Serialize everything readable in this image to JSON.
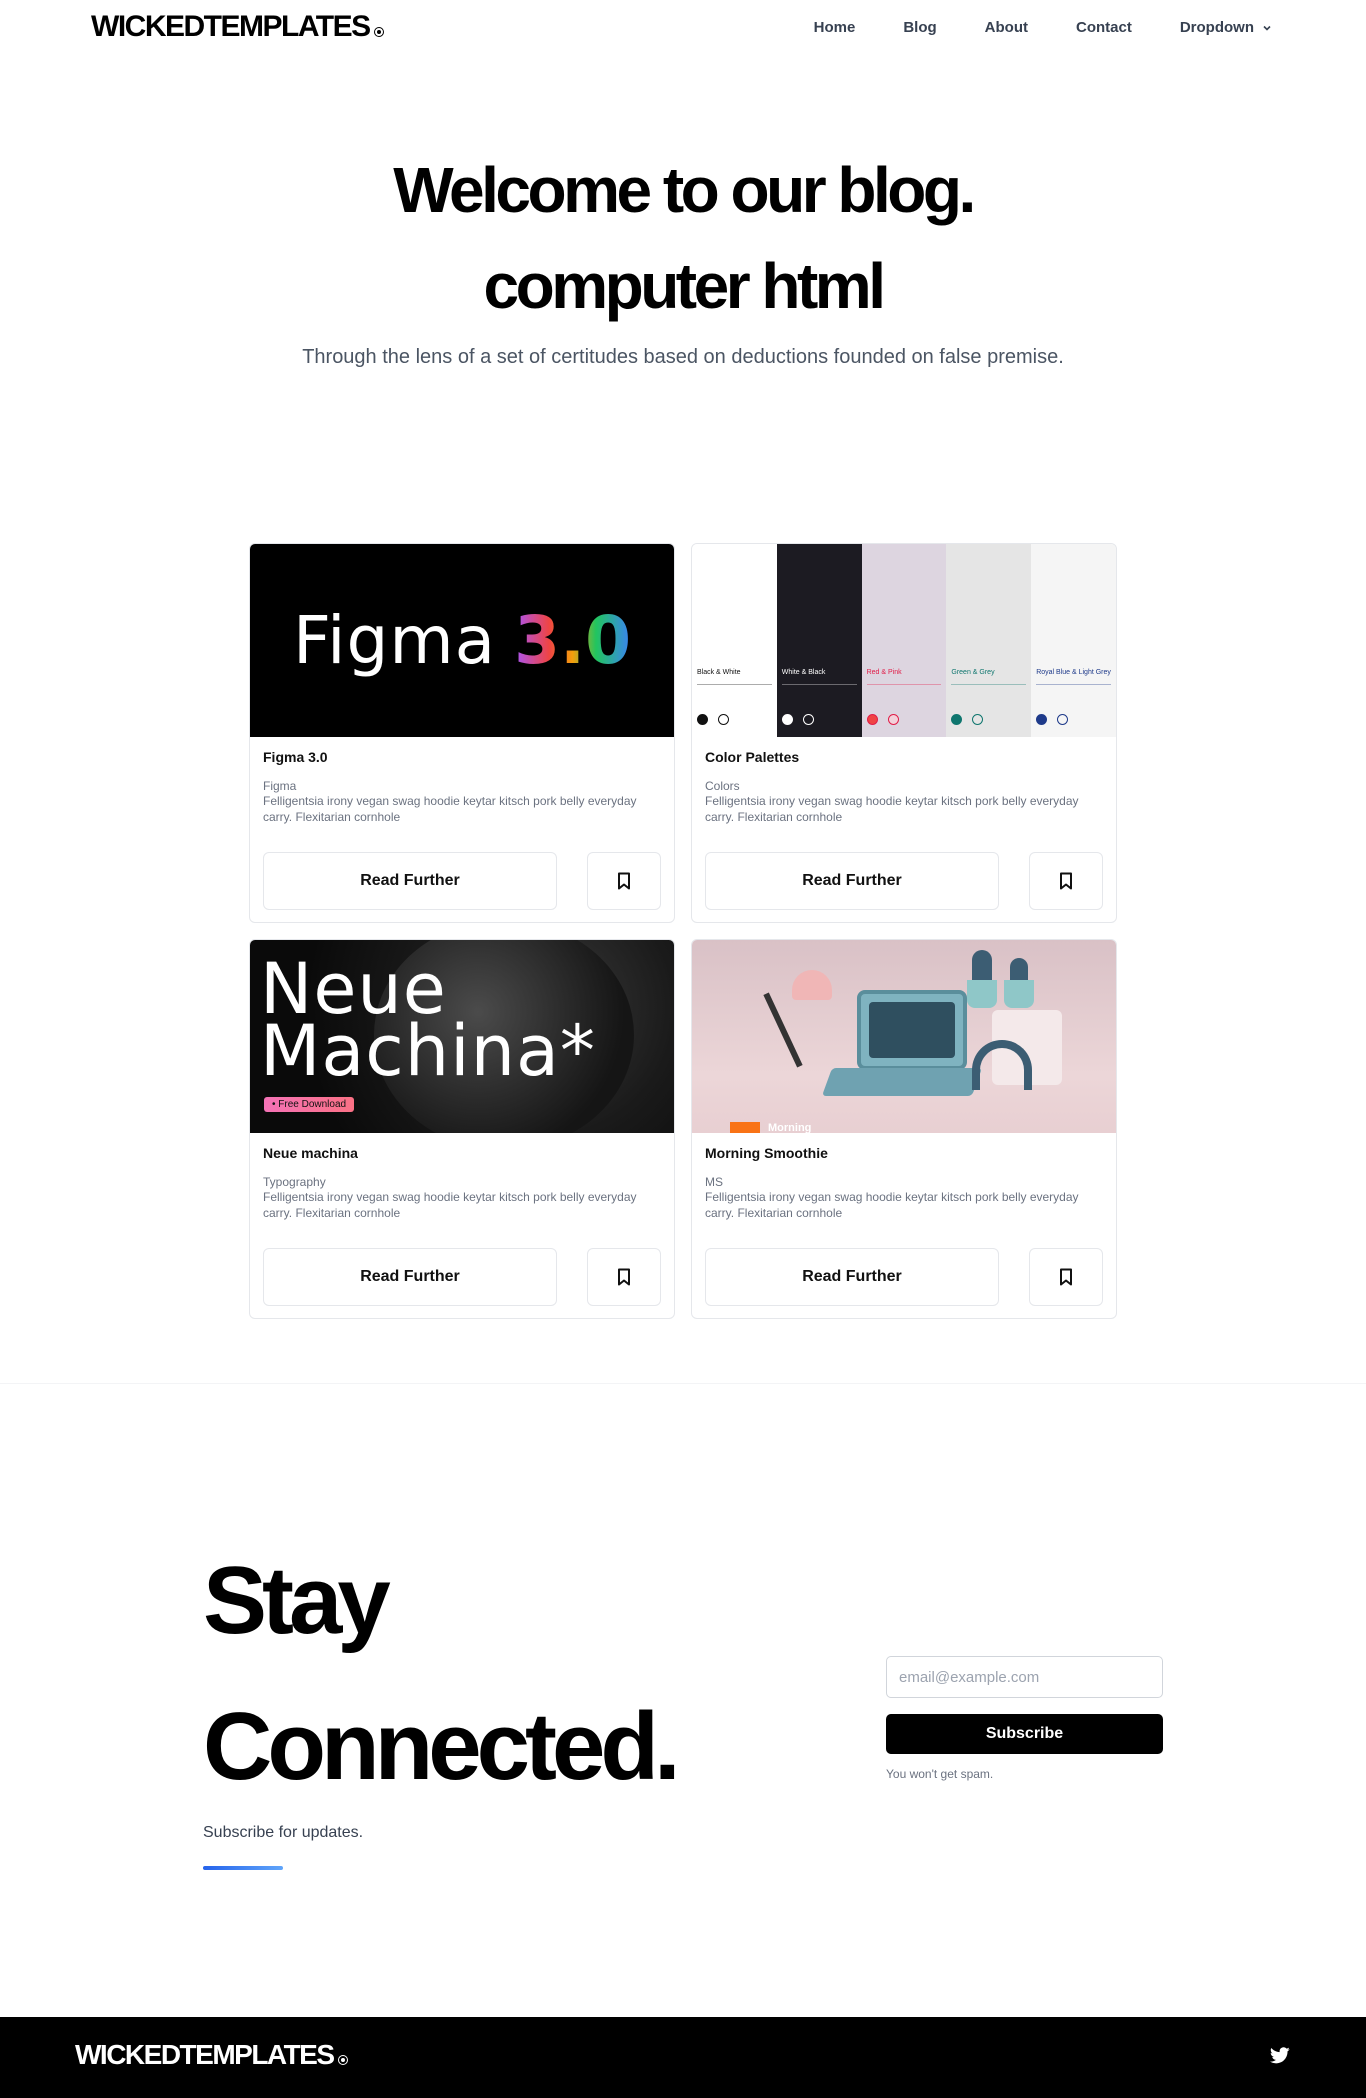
{
  "nav": {
    "brand": "WICKEDTEMPLATES",
    "links": [
      {
        "label": "Home"
      },
      {
        "label": "Blog"
      },
      {
        "label": "About"
      },
      {
        "label": "Contact"
      },
      {
        "label": "Dropdown"
      }
    ]
  },
  "hero": {
    "title_line1": "Welcome to our blog.",
    "title_line2": "computer html",
    "subtitle": "Through the lens of a set of certitudes based on deductions founded on false premise."
  },
  "cards": [
    {
      "title": "Figma 3.0",
      "category": "Figma",
      "description": "Felligentsia irony vegan swag hoodie keytar kitsch pork belly everyday carry. Flexitarian cornhole",
      "button": "Read Further",
      "image_text_1": "Figma",
      "image_text_2": "3.0"
    },
    {
      "title": "Color Palettes",
      "category": "Colors",
      "description": "Felligentsia irony vegan swag hoodie keytar kitsch pork belly everyday carry. Flexitarian cornhole",
      "button": "Read Further",
      "palettes": [
        {
          "label": "Black & White",
          "bg": "#ffffff",
          "fg": "#111111",
          "dot1": "#111111",
          "dot2": "#ffffff"
        },
        {
          "label": "White & Black",
          "bg": "#1c1b22",
          "fg": "#ffffff",
          "dot1": "#ffffff",
          "dot2": "#1c1b22"
        },
        {
          "label": "Red & Pink",
          "bg": "#ddd5e0",
          "fg": "#e11d48",
          "dot1": "#ef4444",
          "dot2": "#f3d1da"
        },
        {
          "label": "Green & Grey",
          "bg": "#e5e5e5",
          "fg": "#0f766e",
          "dot1": "#0f766e",
          "dot2": "#e5e5e5"
        },
        {
          "label": "Royal Blue & Light Grey",
          "bg": "#f5f5f5",
          "fg": "#1e3a8a",
          "dot1": "#1e3a8a",
          "dot2": "#f5f5f5"
        }
      ]
    },
    {
      "title": "Neue machina",
      "category": "Typography",
      "description": "Felligentsia irony vegan swag hoodie keytar kitsch pork belly everyday carry. Flexitarian cornhole",
      "button": "Read Further",
      "image_text_1": "Neue",
      "image_text_2": "Machina*",
      "image_tag": "• Free Download"
    },
    {
      "title": "Morning Smoothie",
      "category": "MS",
      "description": "Felligentsia irony vegan swag hoodie keytar kitsch pork belly everyday carry. Flexitarian cornhole",
      "button": "Read Further",
      "image_text": "Morning"
    }
  ],
  "newsletter": {
    "title_line1": "Stay",
    "title_line2": "Connected.",
    "subtitle": "Subscribe for updates.",
    "email_placeholder": "email@example.com",
    "button": "Subscribe",
    "note": "You won't get spam."
  },
  "footer": {
    "brand": "WICKEDTEMPLATES",
    "social_icon": "twitter-icon"
  }
}
